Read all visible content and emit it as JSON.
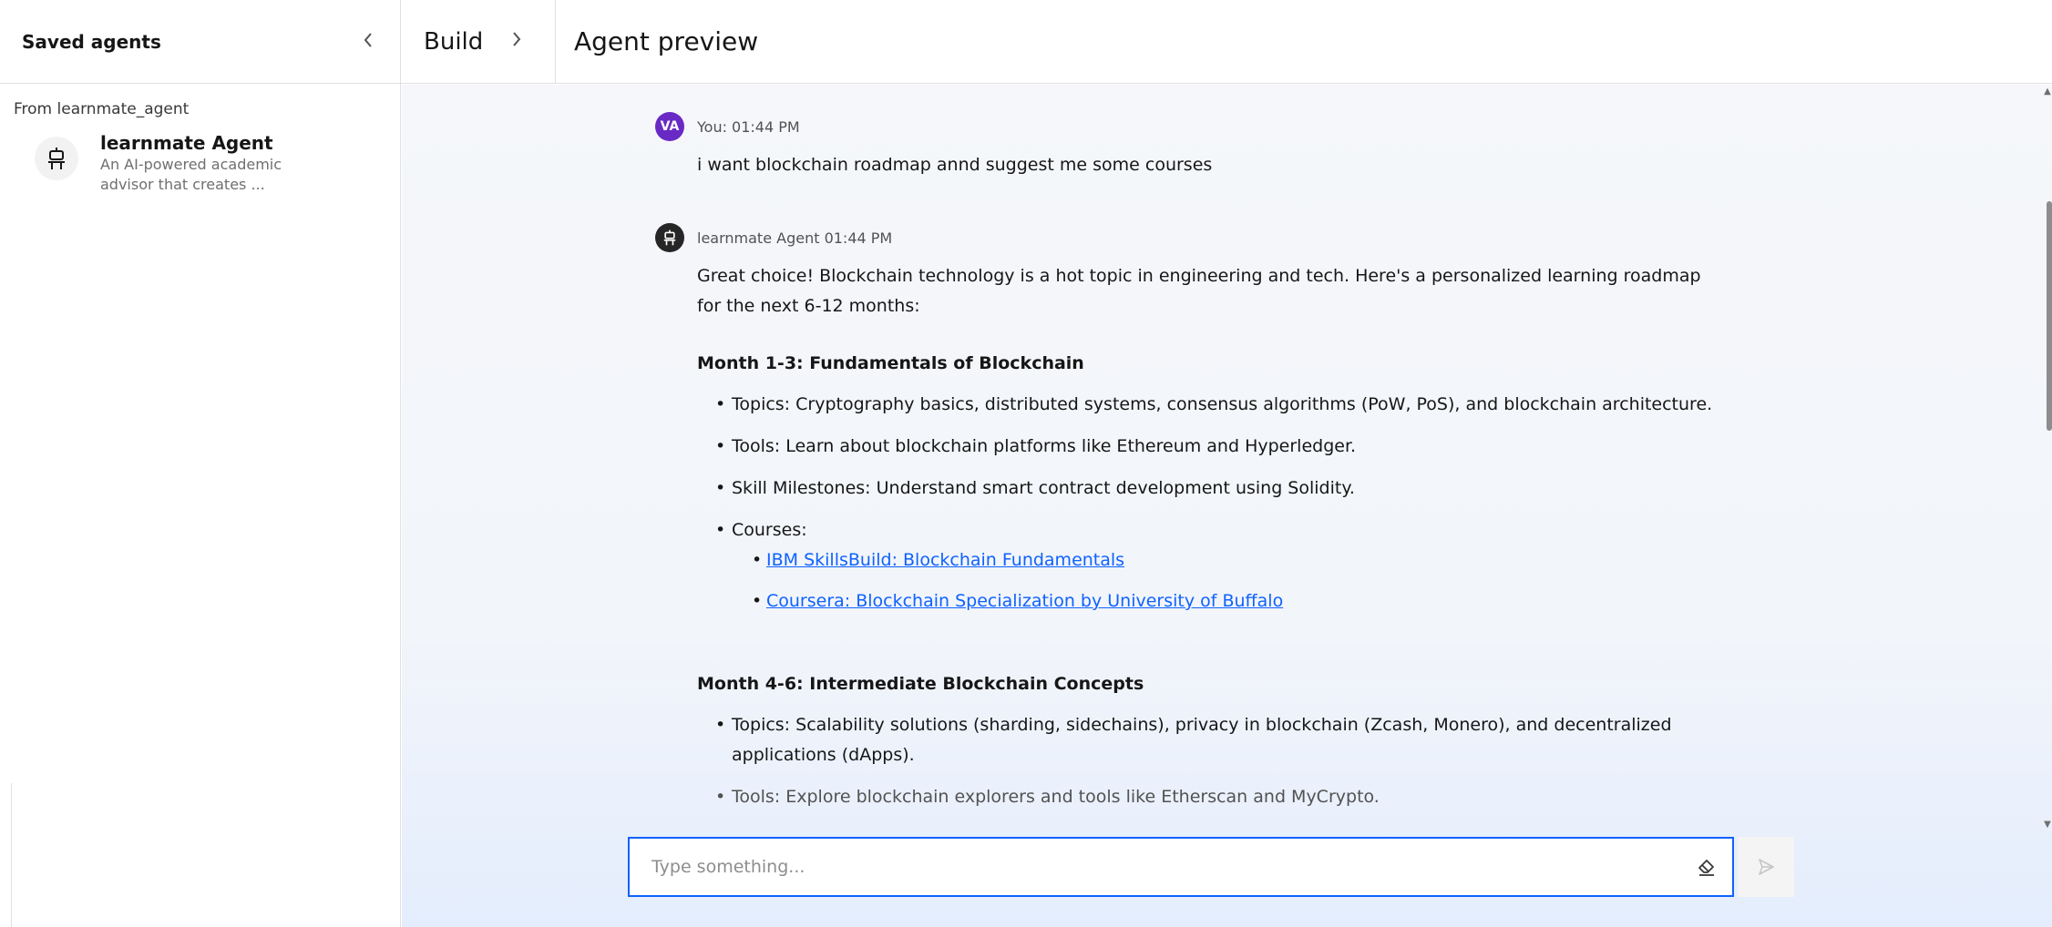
{
  "sidebar": {
    "title": "Saved agents",
    "collapse_icon": "chevron-left-icon",
    "from_label": "From learnmate_agent",
    "agent": {
      "name": "learnmate Agent",
      "description": "An AI-powered academic advisor that creates ...",
      "icon": "robot-icon"
    }
  },
  "header": {
    "build_label": "Build",
    "build_icon": "chevron-right-icon",
    "preview_title": "Agent preview"
  },
  "messages": {
    "user": {
      "avatar": "VA",
      "meta": "You: 01:44 PM",
      "text": "i want blockchain roadmap annd suggest me some courses"
    },
    "agent": {
      "meta": "learnmate Agent 01:44 PM",
      "intro": "Great choice! Blockchain technology is a hot topic in engineering and tech. Here's a personalized learning roadmap for the next 6-12 months:",
      "sections": [
        {
          "title": "Month 1-3: Fundamentals of Blockchain",
          "items": [
            "Topics: Cryptography basics, distributed systems, consensus algorithms (PoW, PoS), and blockchain architecture.",
            "Tools: Learn about blockchain platforms like Ethereum and Hyperledger.",
            "Skill Milestones: Understand smart contract development using Solidity.",
            "Courses:"
          ],
          "courses": [
            "IBM SkillsBuild: Blockchain Fundamentals",
            "Coursera: Blockchain Specialization by University of Buffalo"
          ]
        },
        {
          "title": "Month 4-6: Intermediate Blockchain Concepts",
          "items": [
            "Topics: Scalability solutions (sharding, sidechains), privacy in blockchain (Zcash, Monero), and decentralized applications (dApps).",
            "Tools: Explore blockchain explorers and tools like Etherscan and MyCrypto."
          ]
        }
      ]
    }
  },
  "composer": {
    "placeholder": "Type something...",
    "value": "",
    "clear_icon": "eraser-icon",
    "send_icon": "send-icon"
  },
  "colors": {
    "accent": "#0f62fe",
    "user_avatar": "#6929c4",
    "agent_avatar": "#262626",
    "link": "#0f62fe"
  }
}
